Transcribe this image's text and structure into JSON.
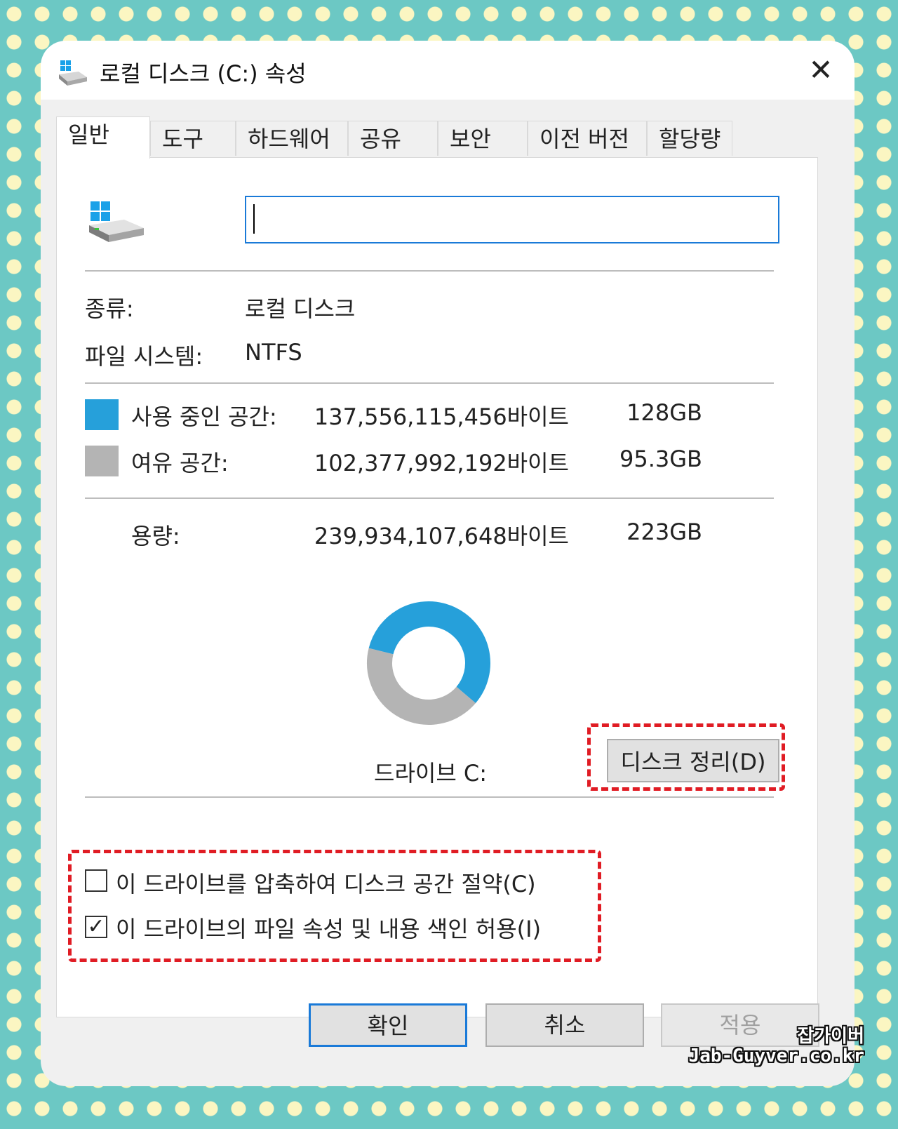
{
  "window": {
    "title": "로컬 디스크 (C:) 속성",
    "close_symbol": "✕"
  },
  "tabs": [
    {
      "label": "일반",
      "active": true
    },
    {
      "label": "도구"
    },
    {
      "label": "하드웨어"
    },
    {
      "label": "공유"
    },
    {
      "label": "보안"
    },
    {
      "label": "이전 버전"
    },
    {
      "label": "할당량"
    }
  ],
  "general": {
    "name_value": "",
    "type_label": "종류:",
    "type_value": "로컬 디스크",
    "fs_label": "파일 시스템:",
    "fs_value": "NTFS",
    "used": {
      "label": "사용 중인 공간:",
      "bytes": "137,556,115,456바이트",
      "size": "128GB",
      "color": "#26a0da"
    },
    "free": {
      "label": "여유 공간:",
      "bytes": "102,377,992,192바이트",
      "size": "95.3GB",
      "color": "#b4b4b4"
    },
    "capacity": {
      "label": "용량:",
      "bytes": "239,934,107,648바이트",
      "size": "223GB"
    },
    "drive_label": "드라이브 C:",
    "cleanup_button": "디스크 정리(D)",
    "compress_checkbox": {
      "label": "이 드라이브를 압축하여 디스크 공간 절약(C)",
      "checked": false
    },
    "index_checkbox": {
      "label": "이 드라이브의 파일 속성 및 내용 색인 허용(I)",
      "checked": true,
      "mark": "✓"
    }
  },
  "buttons": {
    "ok": "확인",
    "cancel": "취소",
    "apply": "적용"
  },
  "watermark": {
    "line1": "잡가이버",
    "line2": "Jab-Guyver.co.kr"
  },
  "chart_data": {
    "type": "pie",
    "categories": [
      "사용 중인 공간",
      "여유 공간"
    ],
    "values": [
      137556115456,
      102377992192
    ],
    "colors": [
      "#26a0da",
      "#b4b4b4"
    ]
  }
}
